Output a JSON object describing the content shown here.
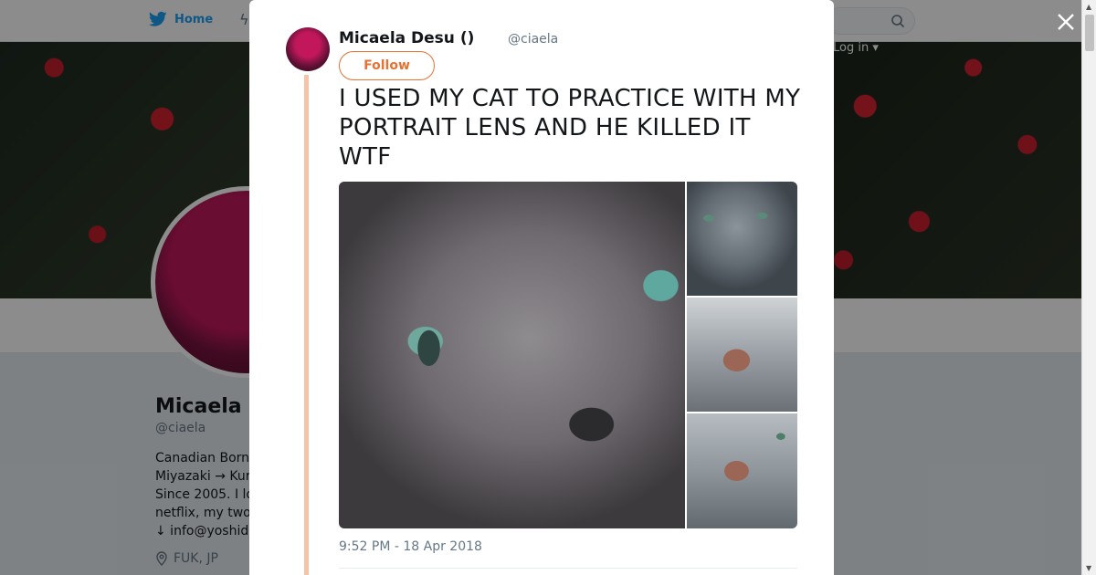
{
  "topbar": {
    "home_label": "Home",
    "moments_glyph": "ϟ",
    "login_label": "Log in ▾"
  },
  "profile": {
    "name": "Micaela D",
    "handle": "@ciaela",
    "bio_lines": [
      "Canadian Born",
      "Miyazaki → Kur",
      "Since 2005. I lo",
      "netflix, my two",
      "↓ info@yoshid"
    ],
    "location": "FUK, JP"
  },
  "tweet": {
    "author_name": "Micaela Desu ()",
    "author_handle": "@ciaela",
    "follow_label": "Follow",
    "text": "I USED MY CAT TO PRACTICE WITH MY PORTRAIT LENS AND HE KILLED IT WTF",
    "timestamp": "9:52 PM - 18 Apr 2018"
  },
  "colors": {
    "twitter_blue": "#1da1f2",
    "follow_accent": "#e67233",
    "thread_line": "#f5c4a8"
  },
  "icons": {
    "close": "close-icon",
    "search": "search-icon",
    "twitter_bird": "twitter-bird-icon",
    "location": "location-pin-icon"
  }
}
